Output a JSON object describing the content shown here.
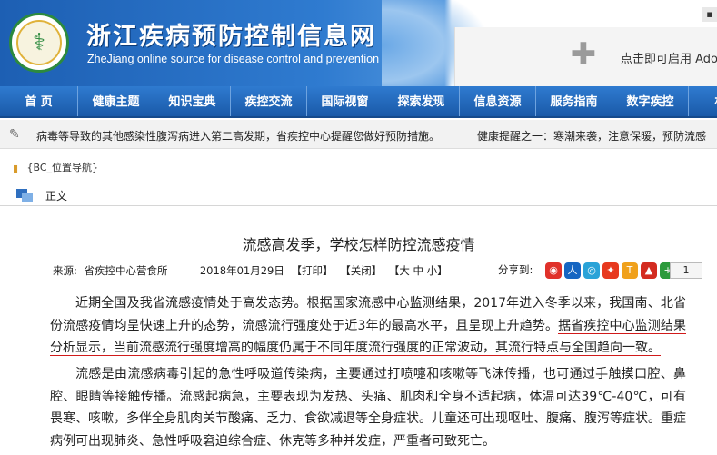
{
  "header": {
    "site_title": "浙江疾病预防控制信息网",
    "site_subtitle": "ZheJiang online source for disease control and prevention",
    "plugin_text": "点击即可启用 Ado"
  },
  "nav": {
    "items": [
      "首 页",
      "健康主题",
      "知识宝典",
      "疾控交流",
      "国际视窗",
      "探索发现",
      "信息资源",
      "服务指南",
      "数字疾控",
      "机构"
    ]
  },
  "ticker": {
    "text1": "病毒等导致的其他感染性腹泻病进入第二高发期，省疾控中心提醒您做好预防措施。",
    "text2": "健康提醒之一：寒潮来袭，注意保暖，预防流感"
  },
  "breadcrumb": {
    "text": "{BC_位置导航}"
  },
  "section": {
    "label": "正文"
  },
  "article": {
    "title": "流感高发季，学校怎样防控流感疫情",
    "source_label": "来源:",
    "source": "省疾控中心营食所",
    "date": "2018年01月29日",
    "print": "【打印】",
    "close": "【关闭】",
    "font_size": "【大 中 小】",
    "share_label": "分享到:",
    "share_count": "1",
    "p1_a": "近期全国及我省流感疫情处于高发态势。根据国家流感中心监测结果，2017年进入冬季以来，我国南、北省份流感疫情均呈快速上升的态势，流感流行强度处于近3年的最高水平，且呈现上升趋势。",
    "p1_b": "据省疾控中心监测结果分析显示，当前流感流行强度增高的幅度仍属于不同年度流行强度的正常波动，其流行特点与全国趋向一致。",
    "p2": "流感是由流感病毒引起的急性呼吸道传染病，主要通过打喷嚏和咳嗽等飞沫传播，也可通过手触摸口腔、鼻腔、眼睛等接触传播。流感起病急，主要表现为发热、头痛、肌肉和全身不适起病，体温可达39℃-40℃，可有畏寒、咳嗽，多伴全身肌肉关节酸痛、乏力、食欲减退等全身症状。儿童还可出现呕吐、腹痛、腹泻等症状。重症病例可出现肺炎、急性呼吸窘迫综合症、休克等多种并发症，严重者可致死亡。"
  },
  "colors": {
    "nav_bg": "#2f7bd0",
    "header_bg": "#1d5fb3",
    "highlight_underline": "#d11a1a"
  }
}
